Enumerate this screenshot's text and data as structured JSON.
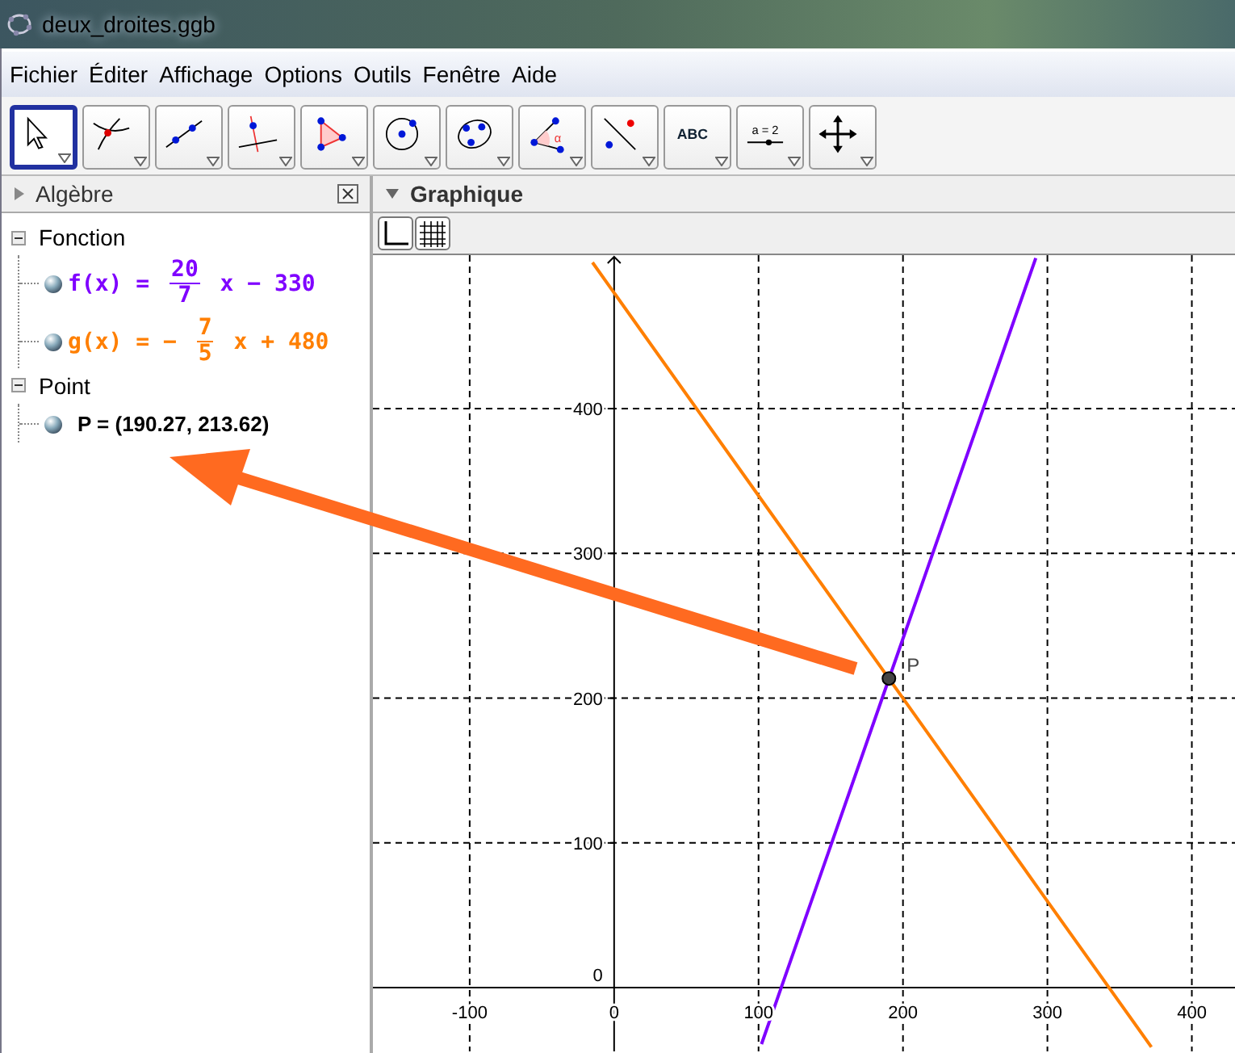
{
  "window": {
    "title": "deux_droites.ggb"
  },
  "menu": [
    "Fichier",
    "Éditer",
    "Affichage",
    "Options",
    "Outils",
    "Fenêtre",
    "Aide"
  ],
  "toolbar": [
    {
      "kind": "pointer",
      "selected": true
    },
    {
      "kind": "intersect",
      "selected": false
    },
    {
      "kind": "line",
      "selected": false
    },
    {
      "kind": "perpendicular",
      "selected": false
    },
    {
      "kind": "polygon",
      "selected": false
    },
    {
      "kind": "circle",
      "selected": false
    },
    {
      "kind": "conic",
      "selected": false
    },
    {
      "kind": "angle",
      "selected": false,
      "label": "α"
    },
    {
      "kind": "reflect",
      "selected": false
    },
    {
      "kind": "text",
      "selected": false,
      "label": "ABC"
    },
    {
      "kind": "slider",
      "selected": false,
      "label": "a = 2"
    },
    {
      "kind": "move",
      "selected": false
    }
  ],
  "algebra": {
    "title": "Algèbre",
    "groups": [
      {
        "label": "Fonction",
        "expanded": true,
        "children": [
          {
            "lhs": "f(x)",
            "eq": "=",
            "num": "20",
            "den": "7",
            "tail": "x − 330",
            "color": "#7f00ff"
          },
          {
            "lhs": "g(x)",
            "eq": "=",
            "sign": "−",
            "num": "7",
            "den": "5",
            "tail": "x + 480",
            "color": "#ff7f00"
          }
        ]
      },
      {
        "label": "Point",
        "expanded": true,
        "children": [
          {
            "text": "P = (190.27, 213.62)",
            "color": "#000000"
          }
        ]
      }
    ]
  },
  "graphics": {
    "title": "Graphique",
    "chart_data": {
      "type": "line",
      "x": [
        -15,
        102,
        200,
        292,
        372
      ],
      "series": [
        {
          "color": "#7f00ff",
          "values": [
            null,
            -39,
            241,
            504,
            null
          ]
        },
        {
          "color": "#ff7f00",
          "values": [
            501,
            337,
            200,
            71,
            -41
          ]
        }
      ],
      "grid": true,
      "xlim": [
        -167,
        431
      ],
      "ylim": [
        -44,
        506
      ],
      "xticks": [
        -100,
        0,
        100,
        200,
        300,
        400
      ],
      "yticks": [
        0,
        100,
        200,
        300,
        400
      ],
      "annotations": [
        {
          "x": 190.27,
          "y": 213.62,
          "text": "P"
        }
      ]
    }
  }
}
